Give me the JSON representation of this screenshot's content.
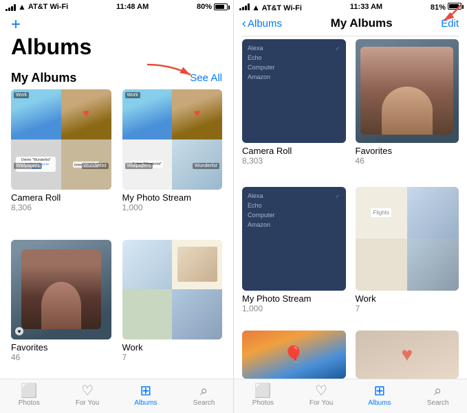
{
  "left": {
    "status": {
      "carrier": "AT&T Wi-Fi",
      "time": "11:48 AM",
      "battery": "80%"
    },
    "title": "Albums",
    "section": {
      "label": "My Albums",
      "see_all": "See All"
    },
    "add_button": "+",
    "albums": [
      {
        "name": "Camera Roll",
        "count": "8,306",
        "thumb_type": "camera_roll"
      },
      {
        "name": "My Photo Stream",
        "count": "1,000",
        "thumb_type": "photo_stream"
      },
      {
        "name": "Favorites",
        "count": "46",
        "thumb_type": "favorites"
      },
      {
        "name": "Work",
        "count": "7",
        "thumb_type": "work"
      }
    ],
    "tabs": [
      {
        "label": "Photos",
        "icon": "🖼",
        "active": false
      },
      {
        "label": "For You",
        "icon": "♡",
        "active": false
      },
      {
        "label": "Albums",
        "icon": "▣",
        "active": true
      },
      {
        "label": "Search",
        "icon": "⌕",
        "active": false
      }
    ]
  },
  "right": {
    "status": {
      "carrier": "AT&T Wi-Fi",
      "time": "11:33 AM",
      "battery": "81%"
    },
    "nav": {
      "back_label": "Albums",
      "title": "My Albums",
      "edit_label": "Edit"
    },
    "albums": [
      {
        "name": "Camera Roll",
        "count": "8,303",
        "thumb_type": "camera_list"
      },
      {
        "name": "Favorites",
        "count": "46",
        "thumb_type": "favorites_photo"
      },
      {
        "name": "My Photo Stream",
        "count": "1,000",
        "thumb_type": "stream_list"
      },
      {
        "name": "Work",
        "count": "7",
        "thumb_type": "work_map"
      }
    ],
    "tabs": [
      {
        "label": "Photos",
        "icon": "🖼",
        "active": false
      },
      {
        "label": "For You",
        "icon": "♡",
        "active": false
      },
      {
        "label": "Albums",
        "icon": "▣",
        "active": true
      },
      {
        "label": "Search",
        "icon": "⌕",
        "active": false
      }
    ],
    "list_items": [
      "Alexa",
      "Echo",
      "Computer",
      "Amazon"
    ]
  }
}
